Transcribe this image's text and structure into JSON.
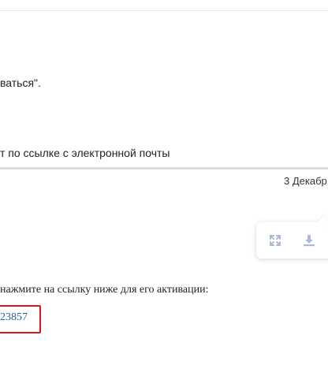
{
  "message1": {
    "text": "ваться\"."
  },
  "message2": {
    "text": "т по ссылке с электронной почты"
  },
  "date": {
    "text": "3 Декабр"
  },
  "toolbar": {
    "expand_icon": "expand-icon",
    "download_icon": "download-icon",
    "icon_color": "#a9b9d6"
  },
  "email": {
    "instruction": "нажмите на ссылку ниже для его активации:",
    "link_text": "23857",
    "link_color": "#2a6496",
    "highlight_color": "#d9161e"
  }
}
